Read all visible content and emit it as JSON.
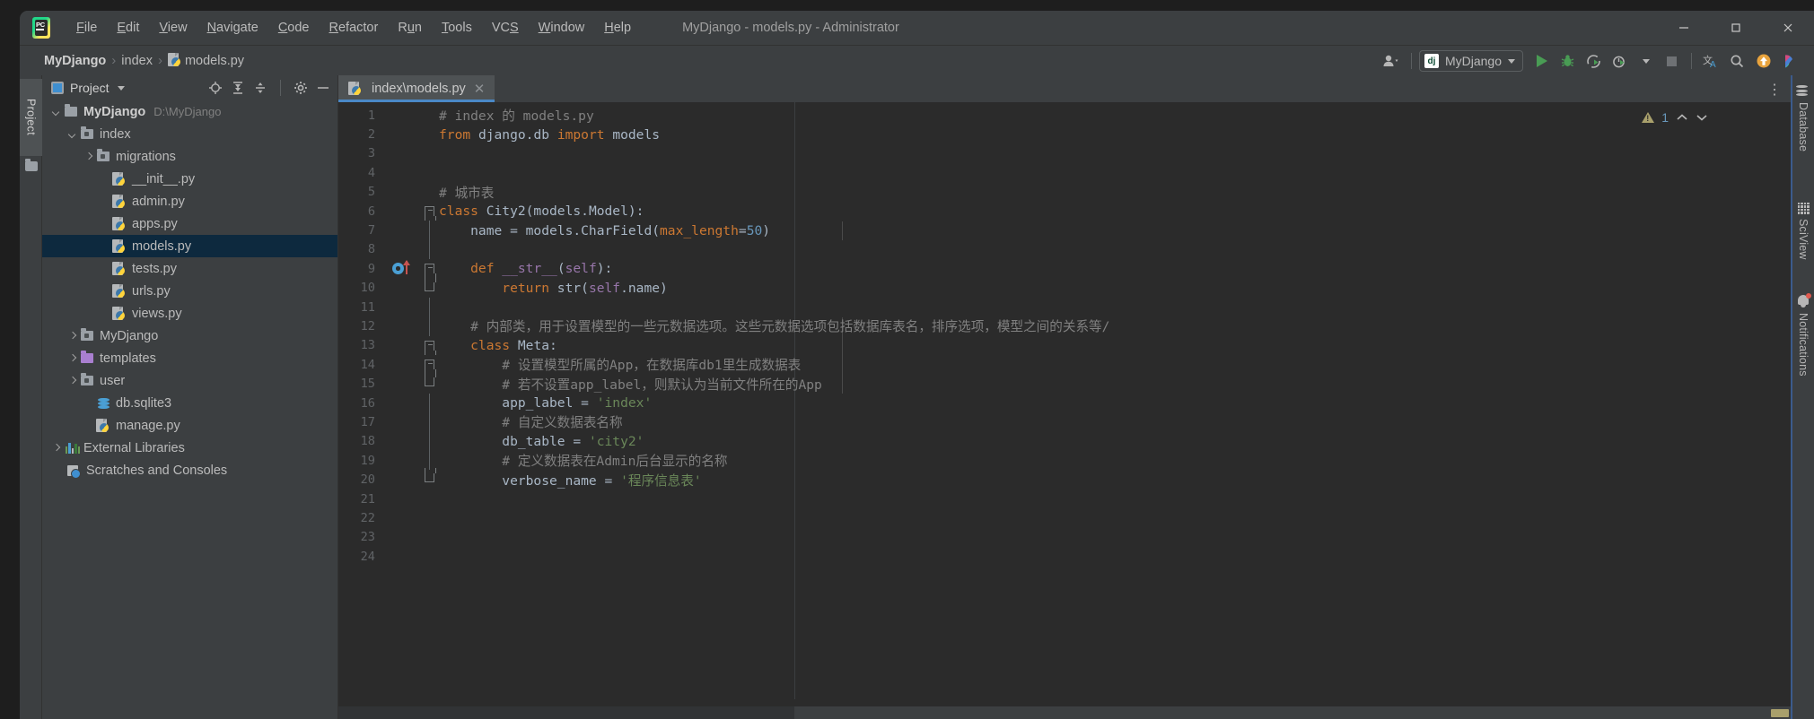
{
  "window": {
    "title": "MyDjango - models.py - Administrator",
    "app_icon": "pycharm-logo-icon",
    "controls": {
      "minimize": "—",
      "maximize": "□",
      "close": "✕"
    }
  },
  "menubar": {
    "items": [
      {
        "label": "File",
        "mnemonic": "F"
      },
      {
        "label": "Edit",
        "mnemonic": "E"
      },
      {
        "label": "View",
        "mnemonic": "V"
      },
      {
        "label": "Navigate",
        "mnemonic": "N"
      },
      {
        "label": "Code",
        "mnemonic": "C"
      },
      {
        "label": "Refactor",
        "mnemonic": "R"
      },
      {
        "label": "Run",
        "mnemonic": "u"
      },
      {
        "label": "Tools",
        "mnemonic": "T"
      },
      {
        "label": "VCS",
        "mnemonic": "S"
      },
      {
        "label": "Window",
        "mnemonic": "W"
      },
      {
        "label": "Help",
        "mnemonic": "H"
      }
    ]
  },
  "navbar": {
    "breadcrumbs": [
      {
        "label": "MyDjango",
        "bold": true,
        "icon": ""
      },
      {
        "label": "index",
        "bold": false,
        "icon": ""
      },
      {
        "label": "models.py",
        "bold": false,
        "icon": "python-file-icon"
      }
    ],
    "separator": "›"
  },
  "toolbar": {
    "user_icon": "user-account-icon",
    "run_config": {
      "label": "MyDjango",
      "icon_text": "dj"
    },
    "buttons": [
      {
        "name": "run-button",
        "icon": "play-icon"
      },
      {
        "name": "debug-button",
        "icon": "bug-icon"
      },
      {
        "name": "run-with-coverage-button",
        "icon": "coverage-icon"
      },
      {
        "name": "profile-button",
        "icon": "profile-icon"
      },
      {
        "name": "stop-button",
        "icon": "stop-icon"
      },
      {
        "name": "translate-button",
        "icon": "translate-icon"
      },
      {
        "name": "search-everywhere-button",
        "icon": "search-icon"
      },
      {
        "name": "update-project-button",
        "icon": "update-arrow-icon"
      },
      {
        "name": "ide-feature-button",
        "icon": "colored-chevron-icon"
      }
    ]
  },
  "left_rail": {
    "tab_label": "Project",
    "folder_icon": "folder-icon"
  },
  "project_panel": {
    "title": "Project",
    "header_icons": [
      "select-opened-file-icon",
      "expand-all-icon",
      "collapse-all-icon",
      "settings-gear-icon",
      "hide-icon"
    ],
    "tree": [
      {
        "label": "MyDjango",
        "path": "D:\\MyDjango",
        "depth": 0,
        "icon": "folder-icon",
        "arrow": "down",
        "bold": true,
        "selected": false
      },
      {
        "label": "index",
        "path": "",
        "depth": 1,
        "icon": "module-folder-icon",
        "arrow": "down",
        "bold": false,
        "selected": false
      },
      {
        "label": "migrations",
        "path": "",
        "depth": 2,
        "icon": "module-folder-icon",
        "arrow": "right",
        "bold": false,
        "selected": false
      },
      {
        "label": "__init__.py",
        "path": "",
        "depth": 3,
        "icon": "python-file-icon",
        "arrow": "none",
        "bold": false,
        "selected": false
      },
      {
        "label": "admin.py",
        "path": "",
        "depth": 3,
        "icon": "python-file-icon",
        "arrow": "none",
        "bold": false,
        "selected": false
      },
      {
        "label": "apps.py",
        "path": "",
        "depth": 3,
        "icon": "python-file-icon",
        "arrow": "none",
        "bold": false,
        "selected": false
      },
      {
        "label": "models.py",
        "path": "",
        "depth": 3,
        "icon": "python-file-icon",
        "arrow": "none",
        "bold": false,
        "selected": true
      },
      {
        "label": "tests.py",
        "path": "",
        "depth": 3,
        "icon": "python-file-icon",
        "arrow": "none",
        "bold": false,
        "selected": false
      },
      {
        "label": "urls.py",
        "path": "",
        "depth": 3,
        "icon": "python-file-icon",
        "arrow": "none",
        "bold": false,
        "selected": false
      },
      {
        "label": "views.py",
        "path": "",
        "depth": 3,
        "icon": "python-file-icon",
        "arrow": "none",
        "bold": false,
        "selected": false
      },
      {
        "label": "MyDjango",
        "path": "",
        "depth": 1,
        "icon": "module-folder-icon",
        "arrow": "right",
        "bold": false,
        "selected": false
      },
      {
        "label": "templates",
        "path": "",
        "depth": 1,
        "icon": "templates-folder-icon",
        "arrow": "right",
        "bold": false,
        "selected": false
      },
      {
        "label": "user",
        "path": "",
        "depth": 1,
        "icon": "module-folder-icon",
        "arrow": "right",
        "bold": false,
        "selected": false
      },
      {
        "label": "db.sqlite3",
        "path": "",
        "depth": 2,
        "icon": "database-file-icon",
        "arrow": "none",
        "bold": false,
        "selected": false
      },
      {
        "label": "manage.py",
        "path": "",
        "depth": 2,
        "icon": "python-file-icon",
        "arrow": "none",
        "bold": false,
        "selected": false
      },
      {
        "label": "External Libraries",
        "path": "",
        "depth": 0,
        "icon": "external-libraries-icon",
        "arrow": "right",
        "bold": false,
        "selected": false
      },
      {
        "label": "Scratches and Consoles",
        "path": "",
        "depth": 0,
        "icon": "scratches-icon",
        "arrow": "none",
        "bold": false,
        "selected": false
      }
    ]
  },
  "editor": {
    "tab": {
      "label": "index\\models.py",
      "icon": "python-file-icon",
      "close": "✕",
      "active": true
    },
    "tab_options_icon": "more-options-icon",
    "inspection": {
      "warning_icon": "warning-triangle-icon",
      "count": "1",
      "prev": "⌃",
      "next": "⌄"
    },
    "lines": [
      {
        "no": "1",
        "gutter": "",
        "fold": "",
        "segments": [
          {
            "t": "# index 的 models.py",
            "c": "c"
          }
        ]
      },
      {
        "no": "2",
        "gutter": "",
        "fold": "",
        "segments": [
          {
            "t": "from ",
            "c": "k"
          },
          {
            "t": "django.db ",
            "c": "t"
          },
          {
            "t": "import ",
            "c": "k"
          },
          {
            "t": "models",
            "c": "t"
          }
        ]
      },
      {
        "no": "3",
        "gutter": "",
        "fold": "",
        "segments": []
      },
      {
        "no": "4",
        "gutter": "",
        "fold": "",
        "segments": []
      },
      {
        "no": "5",
        "gutter": "",
        "fold": "",
        "segments": [
          {
            "t": "# 城市表",
            "c": "c"
          }
        ]
      },
      {
        "no": "6",
        "gutter": "",
        "fold": "open",
        "segments": [
          {
            "t": "class ",
            "c": "k"
          },
          {
            "t": "City2(models.Model):",
            "c": "t"
          }
        ]
      },
      {
        "no": "7",
        "gutter": "",
        "fold": "bar",
        "segments": [
          {
            "t": "    name = models.CharField(",
            "c": "t"
          },
          {
            "t": "max_length",
            "c": "k"
          },
          {
            "t": "=",
            "c": "t"
          },
          {
            "t": "50",
            "c": "n"
          },
          {
            "t": ")",
            "c": "t"
          }
        ]
      },
      {
        "no": "8",
        "gutter": "",
        "fold": "bar",
        "segments": []
      },
      {
        "no": "9",
        "gutter": "override",
        "fold": "open2",
        "segments": [
          {
            "t": "    def ",
            "c": "k"
          },
          {
            "t": "__str__",
            "c": "d"
          },
          {
            "t": "(",
            "c": "t"
          },
          {
            "t": "self",
            "c": "d"
          },
          {
            "t": "):",
            "c": "t"
          }
        ]
      },
      {
        "no": "10",
        "gutter": "",
        "fold": "end",
        "segments": [
          {
            "t": "        return ",
            "c": "k"
          },
          {
            "t": "str(",
            "c": "t"
          },
          {
            "t": "self",
            "c": "d"
          },
          {
            "t": ".name)",
            "c": "t"
          }
        ]
      },
      {
        "no": "11",
        "gutter": "",
        "fold": "bar",
        "segments": []
      },
      {
        "no": "12",
        "gutter": "",
        "fold": "bar",
        "segments": [
          {
            "t": "    # 内部类，用于设置模型的一些元数据选项。这些元数据选项包括数据库表名，排序选项，模型之间的关系等/",
            "c": "c"
          }
        ]
      },
      {
        "no": "13",
        "gutter": "",
        "fold": "open",
        "segments": [
          {
            "t": "    class ",
            "c": "k"
          },
          {
            "t": "Meta:",
            "c": "t"
          }
        ]
      },
      {
        "no": "14",
        "gutter": "",
        "fold": "open3",
        "segments": [
          {
            "t": "        # 设置模型所属的App，在数据库db1里生成数据表",
            "c": "c"
          }
        ]
      },
      {
        "no": "15",
        "gutter": "",
        "fold": "end2",
        "segments": [
          {
            "t": "        # 若不设置app_label，则默认为当前文件所在的App",
            "c": "c"
          }
        ]
      },
      {
        "no": "16",
        "gutter": "",
        "fold": "bar",
        "segments": [
          {
            "t": "        app_label = ",
            "c": "t"
          },
          {
            "t": "'index'",
            "c": "s"
          }
        ]
      },
      {
        "no": "17",
        "gutter": "",
        "fold": "bar",
        "segments": [
          {
            "t": "        # 自定义数据表名称",
            "c": "c"
          }
        ]
      },
      {
        "no": "18",
        "gutter": "",
        "fold": "bar",
        "segments": [
          {
            "t": "        db_table = ",
            "c": "t"
          },
          {
            "t": "'city2'",
            "c": "s"
          }
        ]
      },
      {
        "no": "19",
        "gutter": "",
        "fold": "bar",
        "segments": [
          {
            "t": "        # 定义数据表在Admin后台显示的名称",
            "c": "c"
          }
        ]
      },
      {
        "no": "20",
        "gutter": "",
        "fold": "end",
        "segments": [
          {
            "t": "        verbose_name = ",
            "c": "t"
          },
          {
            "t": "'程序信息表'",
            "c": "s"
          }
        ]
      },
      {
        "no": "21",
        "gutter": "",
        "fold": "",
        "segments": []
      },
      {
        "no": "22",
        "gutter": "",
        "fold": "",
        "segments": []
      },
      {
        "no": "23",
        "gutter": "",
        "fold": "",
        "segments": []
      },
      {
        "no": "24",
        "gutter": "",
        "fold": "",
        "segments": []
      }
    ]
  },
  "right_rail": {
    "items": [
      {
        "label": "Database",
        "icon": "database-icon",
        "badge": false
      },
      {
        "label": "SciView",
        "icon": "grid-icon",
        "badge": false
      },
      {
        "label": "Notifications",
        "icon": "bell-icon",
        "badge": true
      }
    ]
  },
  "colors": {
    "background": "#2b2b2b",
    "chrome": "#3c3f41",
    "accent": "#4a88c7",
    "selection": "#0d293e",
    "keyword": "#cc7832",
    "string": "#6a8759",
    "number": "#6897bb",
    "comment": "#808080",
    "text": "#a9b7c6",
    "dunder": "#9876aa",
    "warning": "#a9a06c"
  }
}
